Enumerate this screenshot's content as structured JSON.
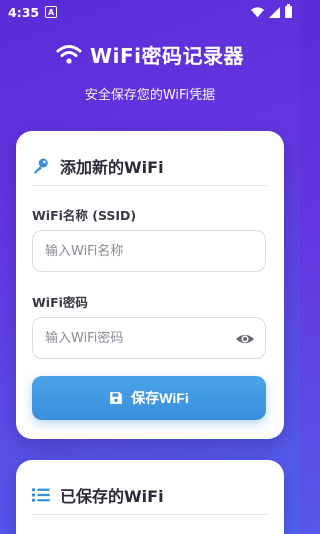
{
  "status_bar": {
    "time": "4:35",
    "badge": "A"
  },
  "header": {
    "title": "WiFi密码记录器",
    "subtitle": "安全保存您的WiFi凭据"
  },
  "add_card": {
    "title": "添加新的WiFi",
    "ssid_label": "WiFi名称 (SSID)",
    "ssid_placeholder": "输入WiFi名称",
    "ssid_value": "",
    "password_label": "WiFi密码",
    "password_placeholder": "输入WiFi密码",
    "password_value": "",
    "save_label": "保存WiFi"
  },
  "saved_card": {
    "title": "已保存的WiFi"
  },
  "colors": {
    "accent": "#3a8fdb",
    "bg_top": "#5b2bd8",
    "bg_bottom": "#4f63ee",
    "key_icon": "#3a8fdb"
  },
  "icons": {
    "header": "wifi-icon",
    "add": "key-icon",
    "save": "floppy-disk-icon",
    "toggle": "eye-icon",
    "saved": "list-icon"
  }
}
